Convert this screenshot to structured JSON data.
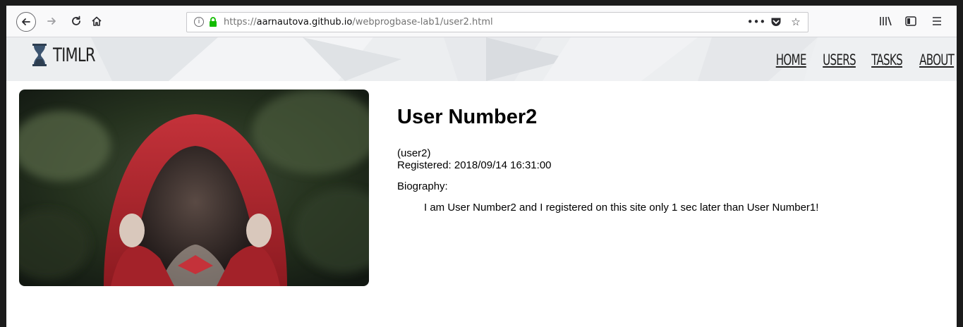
{
  "browser": {
    "url_prefix": "https://",
    "url_host": "aarnautova.github.io",
    "url_path": "/webprogbase-lab1/user2.html",
    "icons": {
      "back": "back-arrow-icon",
      "forward": "forward-arrow-icon",
      "reload": "reload-icon",
      "home": "home-icon",
      "info": "info-icon",
      "lock": "lock-icon",
      "page_actions": "more-actions-icon",
      "pocket": "pocket-icon",
      "bookmark": "star-icon",
      "library": "library-icon",
      "sidebar": "sidebar-icon",
      "menu": "hamburger-menu-icon"
    }
  },
  "site": {
    "logo_text": "TIMLR",
    "logo_icon": "hourglass-icon",
    "nav": [
      "HOME",
      "USERS",
      "TASKS",
      "ABOUT"
    ]
  },
  "profile": {
    "name": "User Number2",
    "username": "(user2)",
    "registered": "Registered: 2018/09/14 16:31:00",
    "biography_label": "Biography:",
    "biography": "I am User Number2 and I registered on this site only 1 sec later than User Number1!"
  },
  "colors": {
    "lock_green": "#12bc00",
    "hood_red": "#b3262b",
    "forest_dark": "#1e2a1c"
  }
}
